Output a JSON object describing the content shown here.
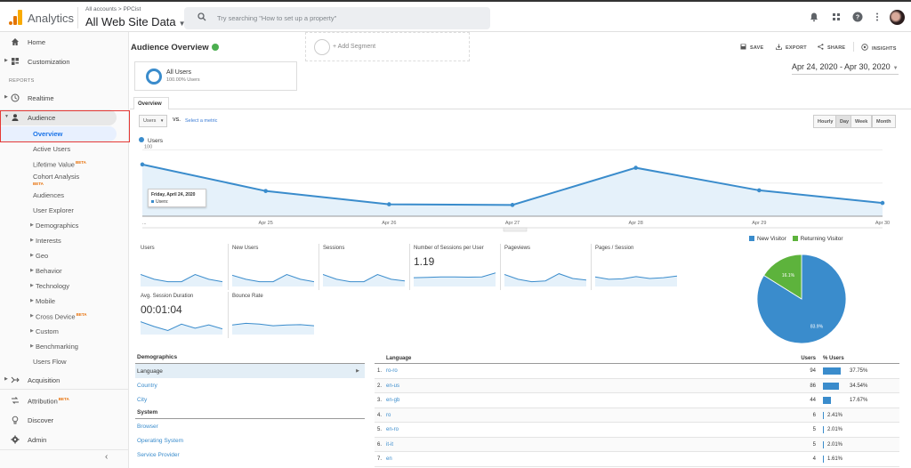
{
  "topbar": {
    "app_name": "Analytics",
    "breadcrumb": "All accounts > PPCist",
    "property": "All Web Site Data",
    "search_placeholder": "Try searching \"How to set up a property\"",
    "icons": [
      "bell-icon",
      "apps-grid-icon",
      "help-icon",
      "more-vert-icon",
      "avatar"
    ]
  },
  "sidebar": {
    "top_items": [
      {
        "label": "Home",
        "icon": "home-icon"
      },
      {
        "label": "Customization",
        "icon": "dashboard-icon"
      }
    ],
    "section_label": "REPORTS",
    "realtime": {
      "label": "Realtime",
      "icon": "clock-icon"
    },
    "audience": {
      "label": "Audience",
      "icon": "person-icon"
    },
    "audience_children": [
      {
        "label": "Overview",
        "active": true
      },
      {
        "label": "Active Users"
      },
      {
        "label": "Lifetime Value",
        "badge": "BETA"
      },
      {
        "label": "Cohort Analysis",
        "badge": "BETA"
      },
      {
        "label": "Audiences"
      },
      {
        "label": "User Explorer"
      },
      {
        "label": "Demographics",
        "expandable": true
      },
      {
        "label": "Interests",
        "expandable": true
      },
      {
        "label": "Geo",
        "expandable": true
      },
      {
        "label": "Behavior",
        "expandable": true
      },
      {
        "label": "Technology",
        "expandable": true
      },
      {
        "label": "Mobile",
        "expandable": true
      },
      {
        "label": "Cross Device",
        "expandable": true,
        "badge": "BETA"
      },
      {
        "label": "Custom",
        "expandable": true
      },
      {
        "label": "Benchmarking",
        "expandable": true
      },
      {
        "label": "Users Flow"
      }
    ],
    "bottom_items": [
      {
        "label": "Acquisition",
        "icon": "acquisition-icon"
      },
      {
        "label": "Attribution",
        "icon": "attribution-icon",
        "badge": "BETA"
      },
      {
        "label": "Discover",
        "icon": "lightbulb-icon"
      },
      {
        "label": "Admin",
        "icon": "gear-icon"
      }
    ],
    "collapse_glyph": "‹"
  },
  "main": {
    "title": "Audience Overview",
    "actions": {
      "save": "SAVE",
      "export": "EXPORT",
      "share": "SHARE",
      "insights": "INSIGHTS"
    },
    "segments": {
      "active": {
        "name": "All Users",
        "sub": "100.00% Users"
      },
      "add": "+ Add Segment"
    },
    "date_range": "Apr 24, 2020 - Apr 30, 2020",
    "tab": "Overview",
    "metric_select": "Users",
    "vs": "VS.",
    "select_metric": "Select a metric",
    "granularity": [
      "Hourly",
      "Day",
      "Week",
      "Month"
    ],
    "granularity_active": "Day",
    "tooltip": {
      "title": "Friday, April 24, 2020",
      "line": "Users:"
    },
    "scorecards": [
      {
        "label": "Users",
        "value": "",
        "spark": [
          0.75,
          0.45,
          0.3,
          0.3,
          0.75,
          0.45,
          0.3
        ]
      },
      {
        "label": "New Users",
        "value": "",
        "spark": [
          0.7,
          0.45,
          0.3,
          0.3,
          0.75,
          0.45,
          0.3
        ]
      },
      {
        "label": "Sessions",
        "value": "",
        "spark": [
          0.75,
          0.45,
          0.3,
          0.3,
          0.75,
          0.45,
          0.35
        ]
      },
      {
        "label": "Number of Sessions per User",
        "value": "1.19",
        "spark": [
          0.55,
          0.57,
          0.6,
          0.6,
          0.58,
          0.6,
          0.85
        ]
      },
      {
        "label": "Pageviews",
        "value": "",
        "spark": [
          0.75,
          0.45,
          0.3,
          0.35,
          0.8,
          0.5,
          0.4
        ]
      },
      {
        "label": "Pages / Session",
        "value": "",
        "spark": [
          0.6,
          0.45,
          0.48,
          0.62,
          0.5,
          0.55,
          0.65
        ]
      },
      {
        "label": "Avg. Session Duration",
        "value": "00:01:04",
        "spark": [
          0.8,
          0.5,
          0.25,
          0.65,
          0.4,
          0.6,
          0.35
        ]
      },
      {
        "label": "Bounce Rate",
        "value": "",
        "spark": [
          0.6,
          0.7,
          0.65,
          0.55,
          0.6,
          0.62,
          0.55
        ]
      }
    ],
    "demographics": {
      "header": "Demographics",
      "items": [
        "Language",
        "Country",
        "City"
      ],
      "active": "Language",
      "system_header": "System",
      "system_items": [
        "Browser",
        "Operating System",
        "Service Provider"
      ]
    },
    "language_table": {
      "headers": {
        "name": "Language",
        "users": "Users",
        "pct": "% Users"
      },
      "rows": [
        {
          "rank": "1.",
          "name": "ro-ro",
          "users": "94",
          "pct": "37.75%",
          "share": 37.75
        },
        {
          "rank": "2.",
          "name": "en-us",
          "users": "86",
          "pct": "34.54%",
          "share": 34.54
        },
        {
          "rank": "3.",
          "name": "en-gb",
          "users": "44",
          "pct": "17.67%",
          "share": 17.67
        },
        {
          "rank": "4.",
          "name": "ro",
          "users": "6",
          "pct": "2.41%",
          "share": 2.41
        },
        {
          "rank": "5.",
          "name": "en-ro",
          "users": "5",
          "pct": "2.01%",
          "share": 2.01
        },
        {
          "rank": "6.",
          "name": "it-it",
          "users": "5",
          "pct": "2.01%",
          "share": 2.01
        },
        {
          "rank": "7.",
          "name": "en",
          "users": "4",
          "pct": "1.61%",
          "share": 1.61
        }
      ]
    }
  },
  "colors": {
    "accent": "#3a8ccc",
    "returning": "#5db33c",
    "beta": "#e8710a",
    "highlight_box": "#e53935"
  },
  "chart_data": [
    {
      "type": "area",
      "title": "",
      "legend": [
        "Users"
      ],
      "x": [
        "Apr 24",
        "Apr 25",
        "Apr 26",
        "Apr 27",
        "Apr 28",
        "Apr 29",
        "Apr 30"
      ],
      "x_tick_labels": [
        "...",
        "Apr 25",
        "Apr 26",
        "Apr 27",
        "Apr 28",
        "Apr 29",
        "Apr 30"
      ],
      "series": [
        {
          "name": "Users",
          "values": [
            78,
            38,
            18,
            17,
            73,
            39,
            20
          ]
        }
      ],
      "y_ticks": [
        50,
        100
      ],
      "ylim": [
        0,
        110
      ],
      "grid": true
    },
    {
      "type": "pie",
      "legend": [
        "New Visitor",
        "Returning Visitor"
      ],
      "legend_position": "top",
      "slices": [
        {
          "label": "New Visitor",
          "value": 83.9,
          "text": "83.9%"
        },
        {
          "label": "Returning Visitor",
          "value": 16.1,
          "text": "16.1%"
        }
      ]
    }
  ]
}
